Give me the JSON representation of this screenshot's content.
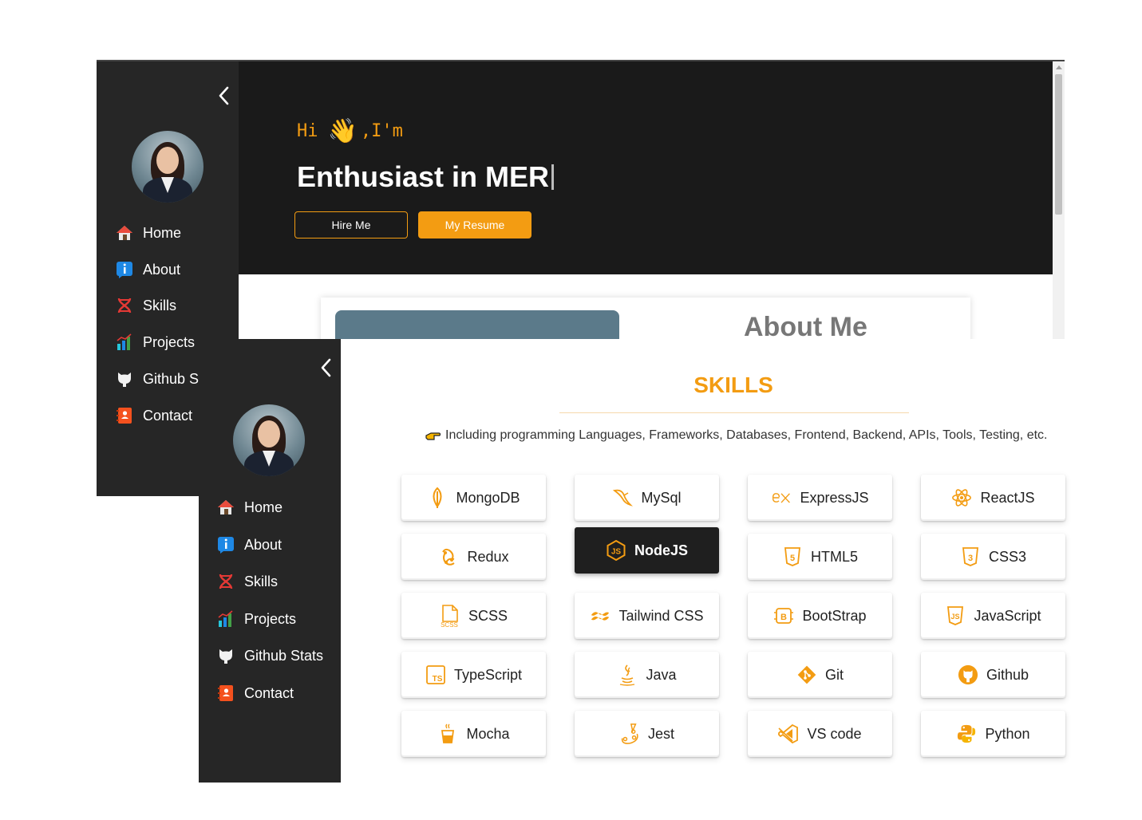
{
  "back": {
    "nav": [
      {
        "label": "Home"
      },
      {
        "label": "About"
      },
      {
        "label": "Skills"
      },
      {
        "label": "Projects"
      },
      {
        "label": "Github St"
      },
      {
        "label": "Contact"
      }
    ],
    "hero": {
      "greeting_hi": "Hi",
      "greeting_wave": "👋",
      "greeting_rest": ",I'm",
      "headline": "Enthusiast in MER",
      "hire_button": "Hire Me",
      "resume_button": "My Resume"
    },
    "about": {
      "title": "About Me"
    }
  },
  "front": {
    "nav": [
      {
        "label": "Home"
      },
      {
        "label": "About"
      },
      {
        "label": "Skills"
      },
      {
        "label": "Projects"
      },
      {
        "label": "Github Stats"
      },
      {
        "label": "Contact"
      }
    ],
    "skills": {
      "title": "SKILLS",
      "description": "Including programming Languages, Frameworks, Databases, Frontend, Backend, APIs, Tools, Testing, etc.",
      "items": [
        {
          "label": "MongoDB",
          "icon": "mongodb-icon"
        },
        {
          "label": "MySql",
          "icon": "mysql-icon"
        },
        {
          "label": "ExpressJS",
          "icon": "express-icon"
        },
        {
          "label": "ReactJS",
          "icon": "react-icon"
        },
        {
          "label": "Redux",
          "icon": "redux-icon"
        },
        {
          "label": "NodeJS",
          "icon": "nodejs-icon",
          "active": true
        },
        {
          "label": "HTML5",
          "icon": "html5-icon"
        },
        {
          "label": "CSS3",
          "icon": "css3-icon"
        },
        {
          "label": "SCSS",
          "icon": "scss-icon"
        },
        {
          "label": "Tailwind CSS",
          "icon": "tailwind-icon"
        },
        {
          "label": "BootStrap",
          "icon": "bootstrap-icon"
        },
        {
          "label": "JavaScript",
          "icon": "javascript-icon"
        },
        {
          "label": "TypeScript",
          "icon": "typescript-icon"
        },
        {
          "label": "Java",
          "icon": "java-icon"
        },
        {
          "label": "Git",
          "icon": "git-icon"
        },
        {
          "label": "Github",
          "icon": "github-icon"
        },
        {
          "label": "Mocha",
          "icon": "mocha-icon"
        },
        {
          "label": "Jest",
          "icon": "jest-icon"
        },
        {
          "label": "VS code",
          "icon": "vscode-icon"
        },
        {
          "label": "Python",
          "icon": "python-icon"
        }
      ]
    }
  },
  "colors": {
    "accent": "#f39c12",
    "sidebar": "#262626",
    "hero": "#1a1a1a"
  }
}
